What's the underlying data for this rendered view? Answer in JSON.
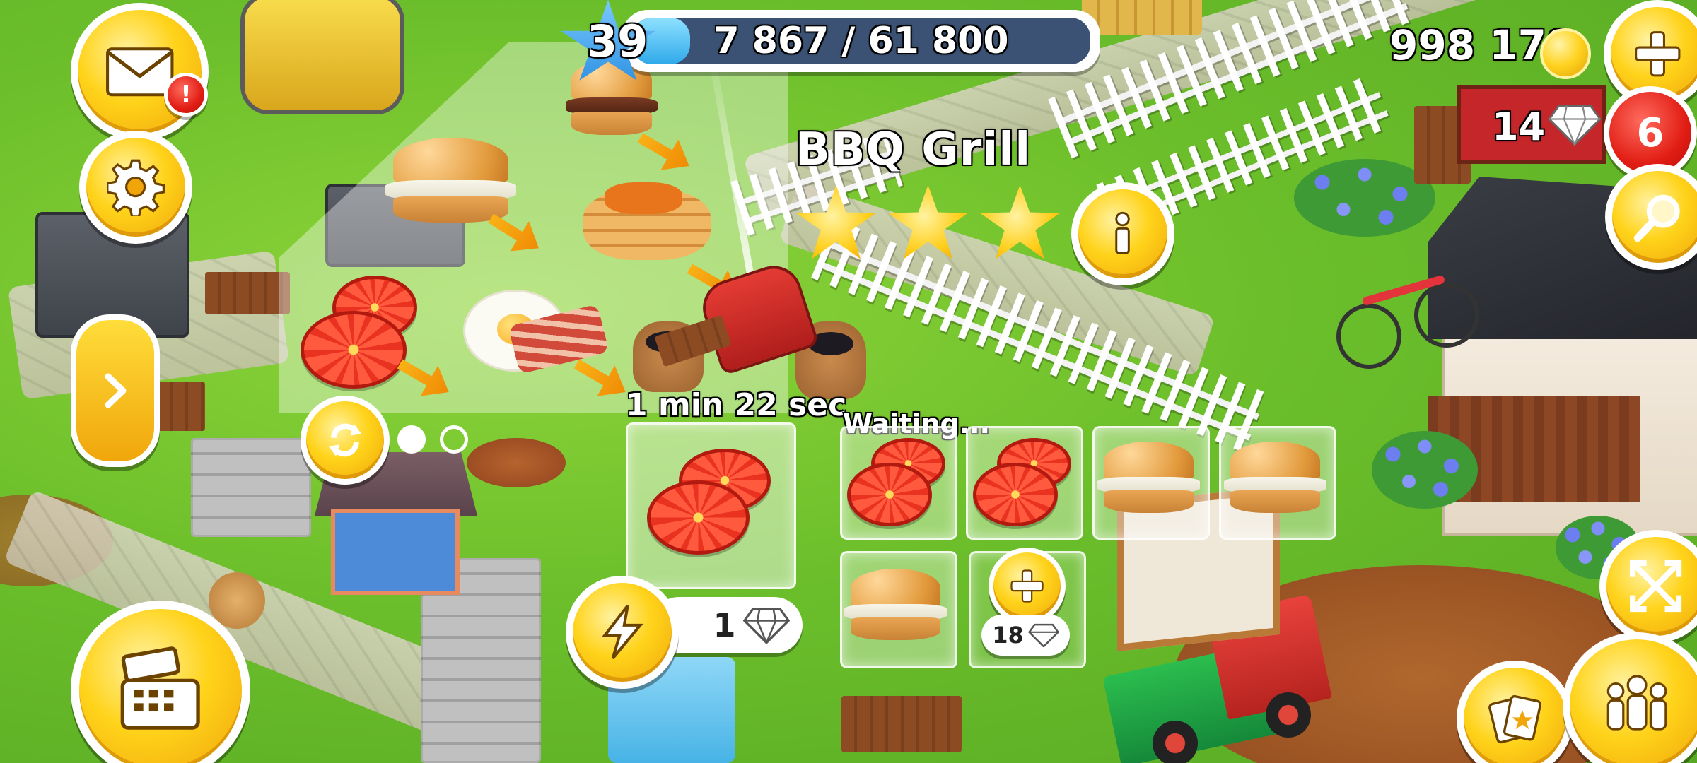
{
  "hud": {
    "level": "39",
    "xp_text": "7 867 / 61 800",
    "xp_progress": 0.127,
    "coins": "998 178",
    "diamonds": "14",
    "notification_count": "6",
    "mail_alert": "!"
  },
  "production": {
    "building_name": "BBQ Grill",
    "star_rating": 3,
    "timer": "1 min 22 sec",
    "queue_label": "Waiting...",
    "skip_cost": "1",
    "unlock_slot_cost": "18",
    "page_count": 2,
    "active_page": 1
  },
  "colors": {
    "hud_yellow": "#ffd31a",
    "badge_red": "#e11d14",
    "xp_blue": "#2fa9ea",
    "grass": "#6cbf2b"
  },
  "icons": {
    "mail": "envelope-icon",
    "settings": "gear-icon",
    "expand": "chevron-right-icon",
    "recycle": "refresh-icon",
    "shop": "cash-register-icon",
    "add_coins": "plus-icon",
    "search": "magnifier-icon",
    "info": "info-icon",
    "skip": "lightning-icon",
    "edit": "expand-arrows-icon",
    "friends": "people-icon",
    "cards": "cards-icon"
  }
}
